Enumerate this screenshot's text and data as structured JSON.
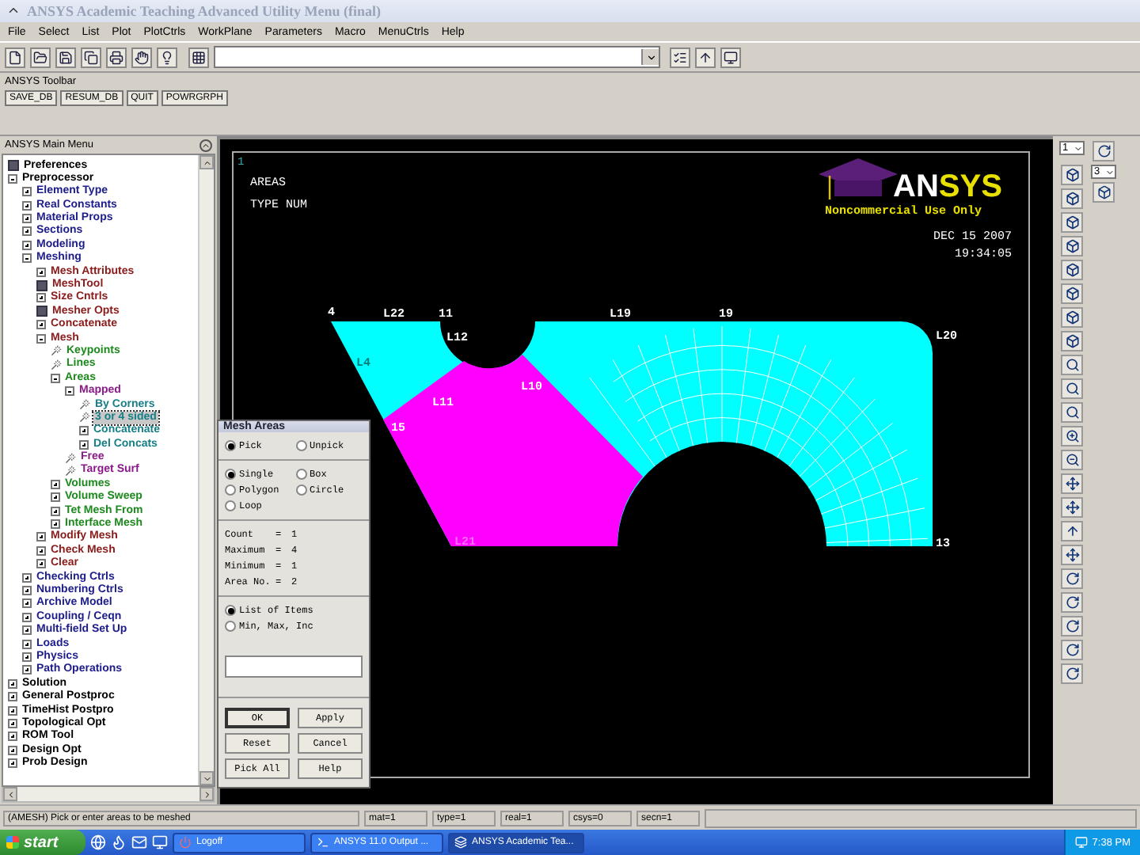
{
  "window": {
    "title": "ANSYS Academic Teaching Advanced Utility Menu (final)"
  },
  "menu_bar": [
    "File",
    "Select",
    "List",
    "Plot",
    "PlotCtrls",
    "WorkPlane",
    "Parameters",
    "Macro",
    "MenuCtrls",
    "Help"
  ],
  "ansys_toolbar": {
    "title": "ANSYS Toolbar",
    "buttons": [
      "SAVE_DB",
      "RESUM_DB",
      "QUIT",
      "POWRGRPH"
    ]
  },
  "main_menu": {
    "title": "ANSYS Main Menu",
    "items": [
      {
        "label": "Preferences",
        "kind": "dialog",
        "selected": false
      },
      {
        "label": "Preprocessor",
        "kind": "node",
        "expanded": true,
        "selected": false,
        "children": [
          {
            "label": "Element Type",
            "kind": "node",
            "expanded": false,
            "selected": false
          },
          {
            "label": "Real Constants",
            "kind": "node",
            "expanded": false,
            "selected": false
          },
          {
            "label": "Material Props",
            "kind": "node",
            "expanded": false,
            "selected": false
          },
          {
            "label": "Sections",
            "kind": "node",
            "expanded": false,
            "selected": false
          },
          {
            "label": "Modeling",
            "kind": "node",
            "expanded": false,
            "selected": false
          },
          {
            "label": "Meshing",
            "kind": "node",
            "expanded": true,
            "selected": false,
            "children": [
              {
                "label": "Mesh Attributes",
                "kind": "node",
                "expanded": false,
                "selected": false
              },
              {
                "label": "MeshTool",
                "kind": "dialog",
                "selected": false
              },
              {
                "label": "Size Cntrls",
                "kind": "node",
                "expanded": false,
                "selected": false
              },
              {
                "label": "Mesher Opts",
                "kind": "dialog",
                "selected": false
              },
              {
                "label": "Concatenate",
                "kind": "node",
                "expanded": false,
                "selected": false
              },
              {
                "label": "Mesh",
                "kind": "node",
                "expanded": true,
                "selected": false,
                "children": [
                  {
                    "label": "Keypoints",
                    "kind": "pick",
                    "selected": false
                  },
                  {
                    "label": "Lines",
                    "kind": "pick",
                    "selected": false
                  },
                  {
                    "label": "Areas",
                    "kind": "node",
                    "expanded": true,
                    "selected": false,
                    "children": [
                      {
                        "label": "Mapped",
                        "kind": "node",
                        "expanded": true,
                        "selected": false,
                        "children": [
                          {
                            "label": "By Corners",
                            "kind": "pick",
                            "selected": false
                          },
                          {
                            "label": "3 or 4 sided",
                            "kind": "pick",
                            "selected": true
                          },
                          {
                            "label": "Concatenate",
                            "kind": "node",
                            "expanded": false,
                            "selected": false
                          },
                          {
                            "label": "Del Concats",
                            "kind": "node",
                            "expanded": false,
                            "selected": false
                          }
                        ]
                      },
                      {
                        "label": "Free",
                        "kind": "pick",
                        "selected": false
                      },
                      {
                        "label": "Target Surf",
                        "kind": "pick",
                        "selected": false
                      }
                    ]
                  },
                  {
                    "label": "Volumes",
                    "kind": "node",
                    "expanded": false,
                    "selected": false
                  },
                  {
                    "label": "Volume Sweep",
                    "kind": "node",
                    "expanded": false,
                    "selected": false
                  },
                  {
                    "label": "Tet Mesh From",
                    "kind": "node",
                    "expanded": false,
                    "selected": false
                  },
                  {
                    "label": "Interface Mesh",
                    "kind": "node",
                    "expanded": false,
                    "selected": false
                  }
                ]
              },
              {
                "label": "Modify Mesh",
                "kind": "node",
                "expanded": false,
                "selected": false
              },
              {
                "label": "Check Mesh",
                "kind": "node",
                "expanded": false,
                "selected": false
              },
              {
                "label": "Clear",
                "kind": "node",
                "expanded": false,
                "selected": false
              }
            ]
          },
          {
            "label": "Checking Ctrls",
            "kind": "node",
            "expanded": false,
            "selected": false
          },
          {
            "label": "Numbering Ctrls",
            "kind": "node",
            "expanded": false,
            "selected": false
          },
          {
            "label": "Archive Model",
            "kind": "node",
            "expanded": false,
            "selected": false
          },
          {
            "label": "Coupling / Ceqn",
            "kind": "node",
            "expanded": false,
            "selected": false
          },
          {
            "label": "Multi-field Set Up",
            "kind": "node",
            "expanded": false,
            "selected": false
          },
          {
            "label": "Loads",
            "kind": "node",
            "expanded": false,
            "selected": false
          },
          {
            "label": "Physics",
            "kind": "node",
            "expanded": false,
            "selected": false
          },
          {
            "label": "Path Operations",
            "kind": "node",
            "expanded": false,
            "selected": false
          }
        ]
      },
      {
        "label": "Solution",
        "kind": "node",
        "expanded": false,
        "selected": false
      },
      {
        "label": "General Postproc",
        "kind": "node",
        "expanded": false,
        "selected": false
      },
      {
        "label": "TimeHist Postpro",
        "kind": "node",
        "expanded": false,
        "selected": false
      },
      {
        "label": "Topological Opt",
        "kind": "node",
        "expanded": false,
        "selected": false
      },
      {
        "label": "ROM Tool",
        "kind": "node",
        "expanded": false,
        "selected": false
      },
      {
        "label": "Design Opt",
        "kind": "node",
        "expanded": false,
        "selected": false
      },
      {
        "label": "Prob Design",
        "kind": "node",
        "expanded": false,
        "selected": false
      }
    ]
  },
  "graphics": {
    "window_number": "1",
    "titles": [
      "AREAS",
      "TYPE NUM"
    ],
    "logo": [
      "AN",
      "SYS"
    ],
    "notice": "Noncommercial Use Only",
    "date": "DEC 15 2007",
    "time": "19:34:05",
    "labels": [
      {
        "text": "4",
        "color": "#ffffff"
      },
      {
        "text": "L22",
        "color": "#ffffff"
      },
      {
        "text": "11",
        "color": "#ffffff"
      },
      {
        "text": "L12",
        "color": "#ffffff"
      },
      {
        "text": "L19",
        "color": "#ffffff"
      },
      {
        "text": "19",
        "color": "#ffffff"
      },
      {
        "text": "L20",
        "color": "#ffffff"
      },
      {
        "text": "L4",
        "color": "#008080"
      },
      {
        "text": "L11",
        "color": "#ffffff"
      },
      {
        "text": "L10",
        "color": "#ffffff"
      },
      {
        "text": "15",
        "color": "#ffffff"
      },
      {
        "text": "L21",
        "color": "#ff66ff"
      },
      {
        "text": "13",
        "color": "#ffffff"
      }
    ]
  },
  "view_controls": {
    "window_select": "1",
    "view_select": "3"
  },
  "mesh_areas_dialog": {
    "title": "Mesh Areas",
    "pick_mode": [
      {
        "label": "Pick",
        "selected": true
      },
      {
        "label": "Unpick",
        "selected": false
      }
    ],
    "pick_shape": [
      {
        "label": "Single",
        "selected": true
      },
      {
        "label": "Box",
        "selected": false
      },
      {
        "label": "Polygon",
        "selected": false
      },
      {
        "label": "Circle",
        "selected": false
      },
      {
        "label": "Loop",
        "selected": false
      }
    ],
    "readouts": [
      {
        "label": "Count",
        "sign": "=",
        "value": "1"
      },
      {
        "label": "Maximum",
        "sign": "=",
        "value": "4"
      },
      {
        "label": "Minimum",
        "sign": "=",
        "value": "1"
      },
      {
        "label": "Area No.",
        "sign": "=",
        "value": "2"
      }
    ],
    "entry_mode": [
      {
        "label": "List of Items",
        "selected": true
      },
      {
        "label": "Min, Max, Inc",
        "selected": false
      }
    ],
    "buttons": [
      "OK",
      "Apply",
      "Reset",
      "Cancel",
      "Pick All",
      "Help"
    ]
  },
  "status_bar": {
    "prompt": "(AMESH) Pick or enter areas to be meshed",
    "fields": [
      "mat=1",
      "type=1",
      "real=1",
      "csys=0",
      "secn=1"
    ]
  },
  "taskbar": {
    "start": "start",
    "tasks": [
      {
        "label": "Logoff",
        "kind": "logoff",
        "selected": false
      },
      {
        "label": "ANSYS 11.0 Output ...",
        "kind": "console",
        "selected": false
      },
      {
        "label": "ANSYS Academic Tea...",
        "kind": "ansys",
        "selected": true
      }
    ],
    "clock": "7:38 PM"
  }
}
